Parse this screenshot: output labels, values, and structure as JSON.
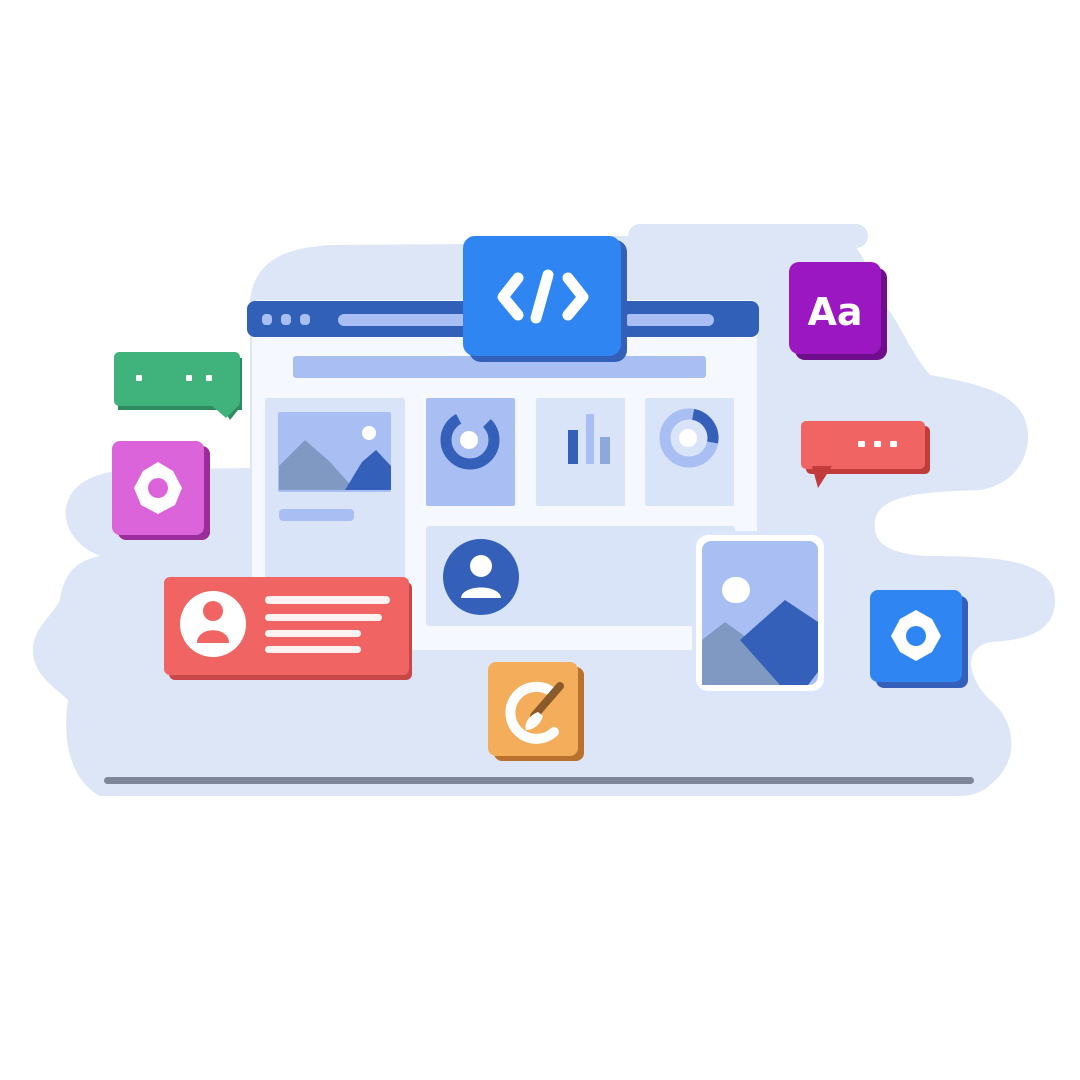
{
  "illustration": {
    "colors": {
      "background": "#ffffff",
      "cloud": "#dde6f7",
      "window_frame": "#3160b8",
      "window_body": "#f5f8fe",
      "panel_light": "#dae4f9",
      "panel_medium": "#a9bff4",
      "accent_blue": "#2f86f2",
      "deep_blue": "#3460b9",
      "green": "#40b37d",
      "pink": "#dc64db",
      "red": "#f06463",
      "purple": "#9b17c1",
      "orange": "#f4ad5a",
      "baseline": "#7d8799"
    },
    "icons": {
      "code_badge": "code-brackets-icon",
      "font_badge": "font-aa-icon",
      "font_badge_text": "Aa",
      "green_bubble": "chat-bubble-icon",
      "red_bubble": "chat-bubble-icon",
      "pink_badge": "gear-icon",
      "blue_badge": "gear-icon",
      "profile_card": "user-avatar-icon",
      "center_avatar": "user-avatar-icon",
      "picture_card": "image-icon",
      "orange_badge": "paint-brush-icon"
    }
  }
}
